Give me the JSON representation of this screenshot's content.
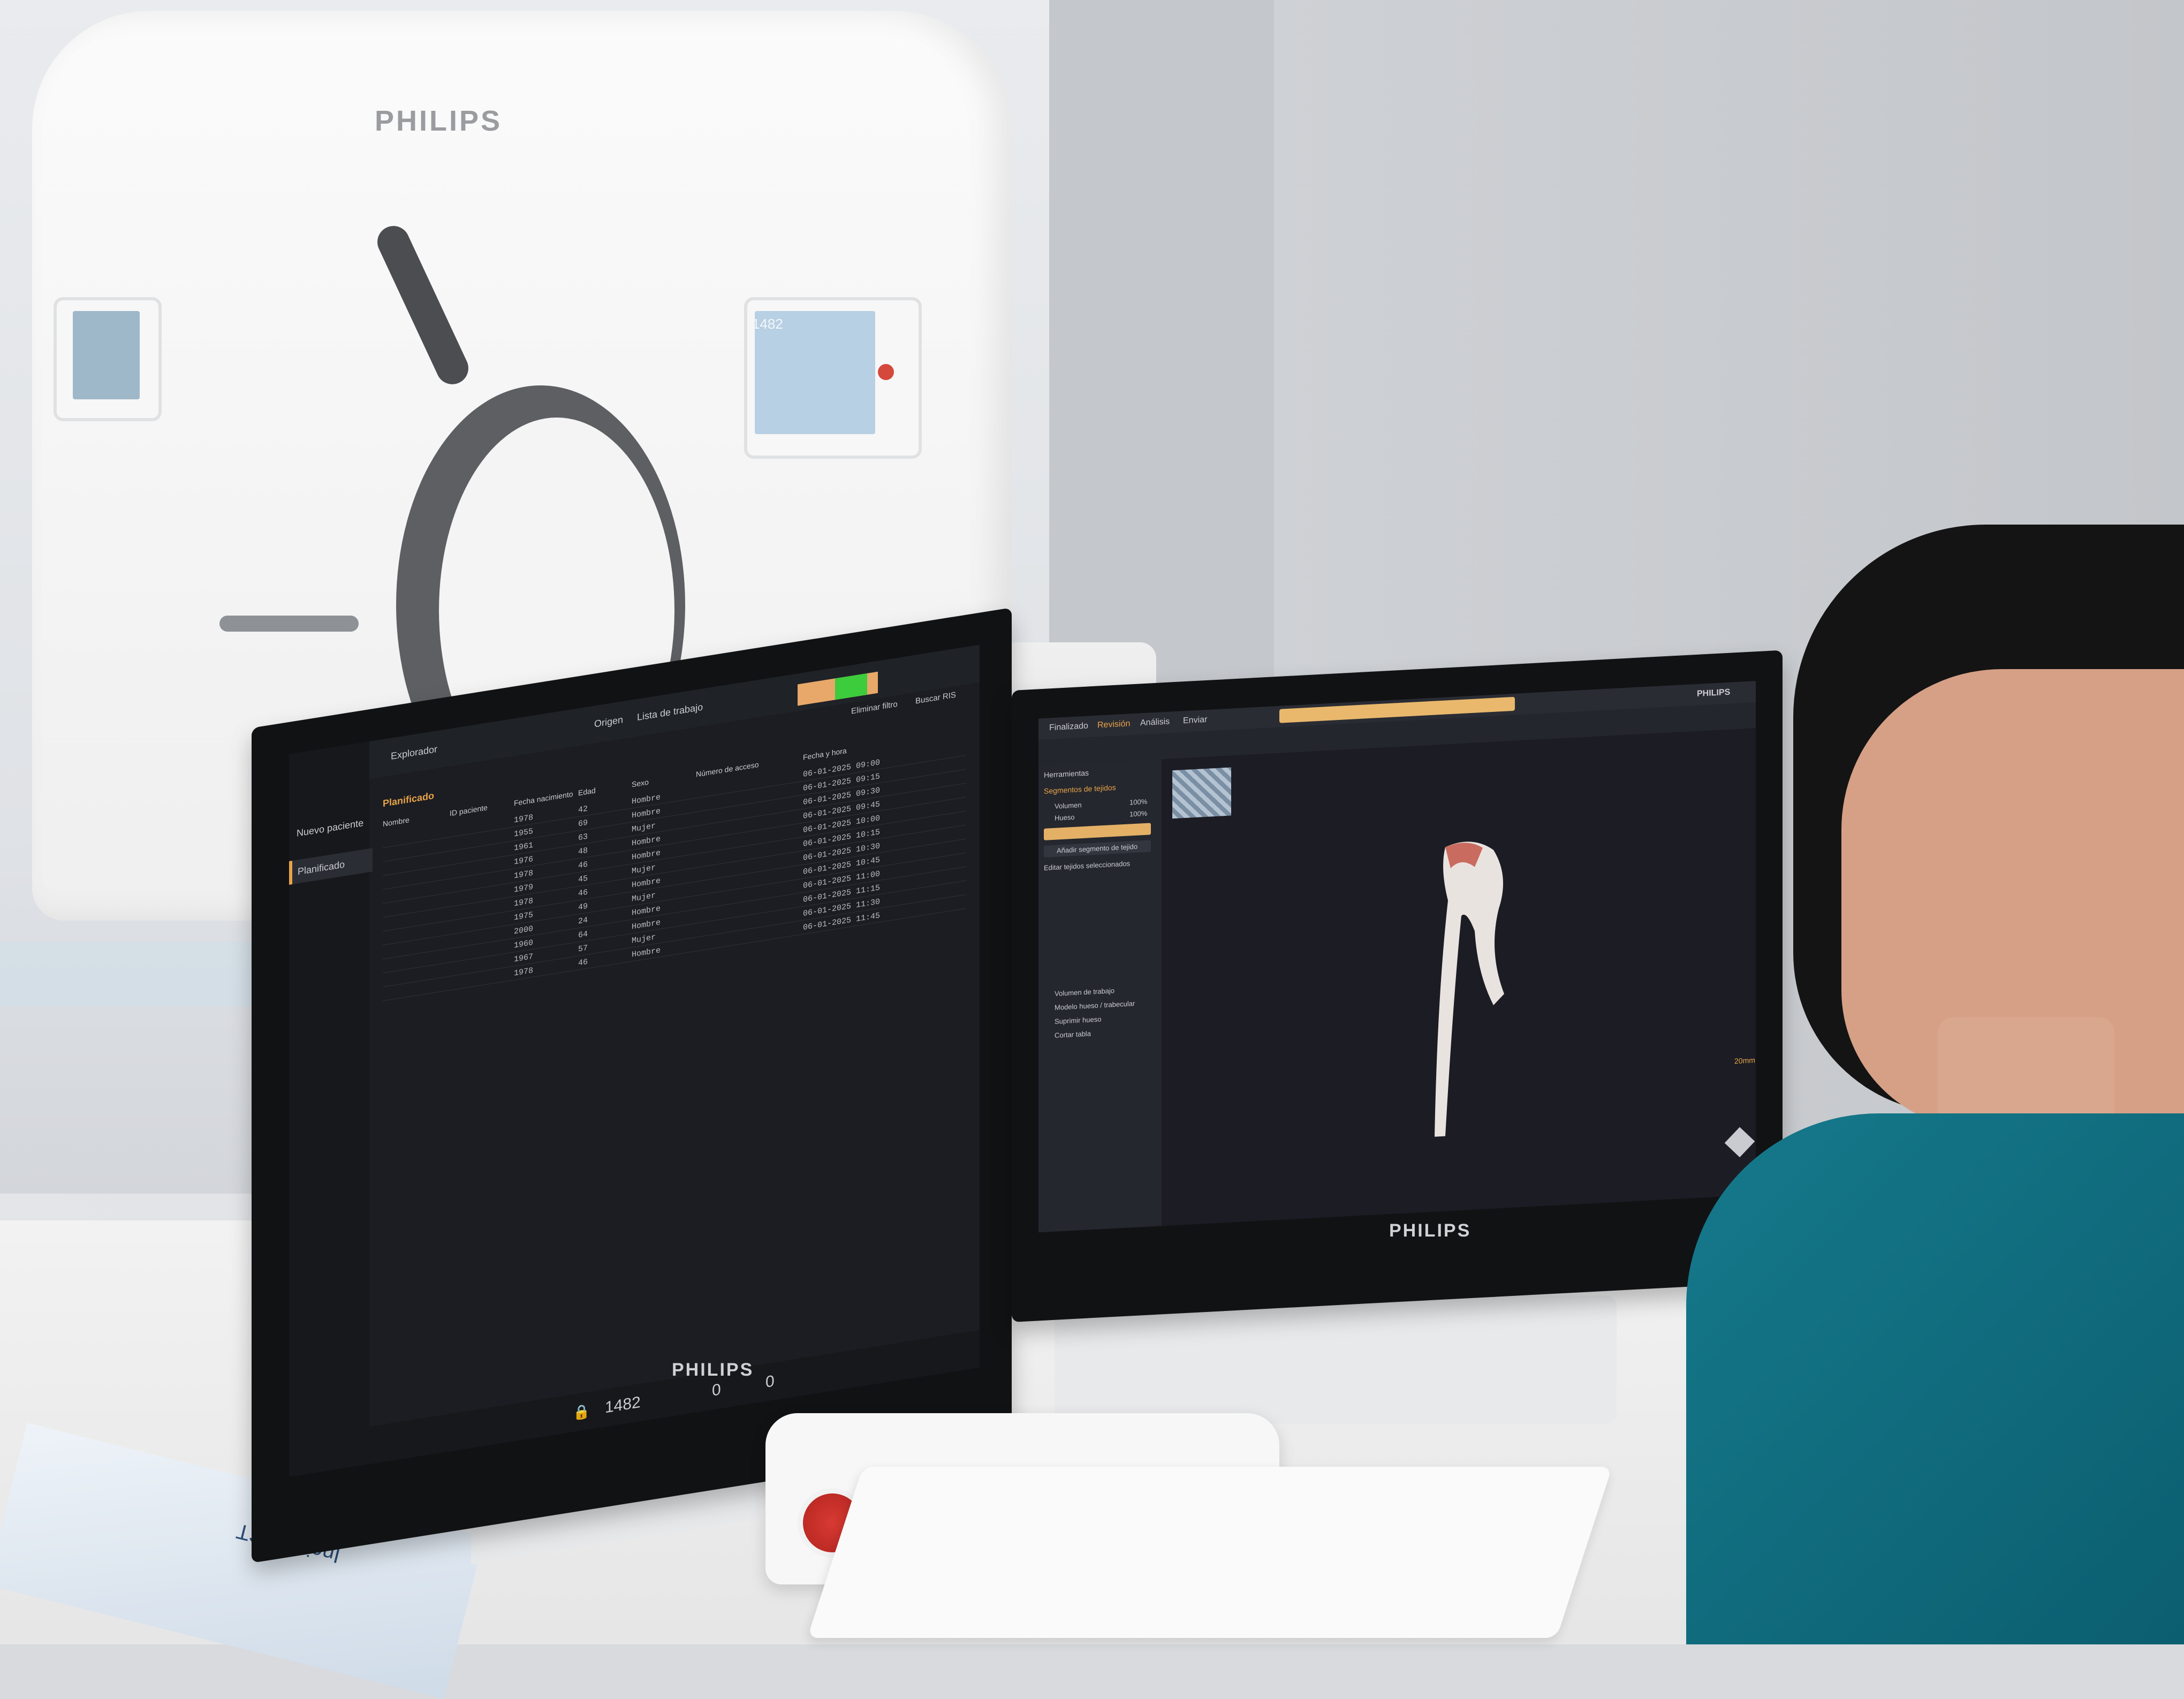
{
  "scene": {
    "gantry_brand": "PHILIPS",
    "gantry_panel_readout": "1482",
    "manual_cover_text": "Incisive CT"
  },
  "left_monitor": {
    "brand": "PHILIPS",
    "sidebar": {
      "items": [
        {
          "label": "Nuevo paciente"
        },
        {
          "label": "Planificado"
        }
      ]
    },
    "top_bar": {
      "explorer_label": "Explorador",
      "filter_button": "Eliminar filtro",
      "search_button": "Buscar RIS",
      "origin_label": "Origen",
      "origin_value": "Lista de trabajo"
    },
    "worklist": {
      "section_title": "Planificado",
      "columns": [
        "Nombre",
        "ID paciente",
        "Fecha nacimiento",
        "Edad",
        "Sexo",
        "Número de acceso",
        "Fecha y hora"
      ],
      "rows": [
        [
          "1978",
          "42",
          "Hombre",
          "06-01-2025 09:00"
        ],
        [
          "1955",
          "69",
          "Hombre",
          "06-01-2025 09:15"
        ],
        [
          "1961",
          "63",
          "Mujer",
          "06-01-2025 09:30"
        ],
        [
          "1976",
          "48",
          "Hombre",
          "06-01-2025 09:45"
        ],
        [
          "1978",
          "46",
          "Hombre",
          "06-01-2025 10:00"
        ],
        [
          "1979",
          "45",
          "Mujer",
          "06-01-2025 10:15"
        ],
        [
          "1978",
          "46",
          "Hombre",
          "06-01-2025 10:30"
        ],
        [
          "1975",
          "49",
          "Mujer",
          "06-01-2025 10:45"
        ],
        [
          "2000",
          "24",
          "Hombre",
          "06-01-2025 11:00"
        ],
        [
          "1960",
          "64",
          "Hombre",
          "06-01-2025 11:15"
        ],
        [
          "1967",
          "57",
          "Mujer",
          "06-01-2025 11:30"
        ],
        [
          "1978",
          "46",
          "Hombre",
          "06-01-2025 11:45"
        ]
      ]
    },
    "status_bar": {
      "counter": "1482",
      "left_value": "0",
      "right_value": "0"
    }
  },
  "right_monitor": {
    "brand": "PHILIPS",
    "tabs": [
      {
        "label": "Finalizado"
      },
      {
        "label": "Revisión"
      },
      {
        "label": "Análisis"
      },
      {
        "label": "Enviar"
      }
    ],
    "panel": {
      "header": "Herramientas",
      "segmentation_title": "Segmentos de tejidos",
      "segments": [
        {
          "name": "Volumen",
          "value": "100%"
        },
        {
          "name": "Hueso",
          "value": "100%"
        }
      ],
      "add_segment_button": "Añadir segmento de tejido",
      "edit_selected_label": "Editar tejidos seleccionados",
      "tool_items": [
        "Volumen de trabajo",
        "Modelo hueso / trabecular",
        "Suprimir hueso",
        "Cortar tabla"
      ]
    },
    "viewport": {
      "scale_label": "20mm"
    }
  }
}
